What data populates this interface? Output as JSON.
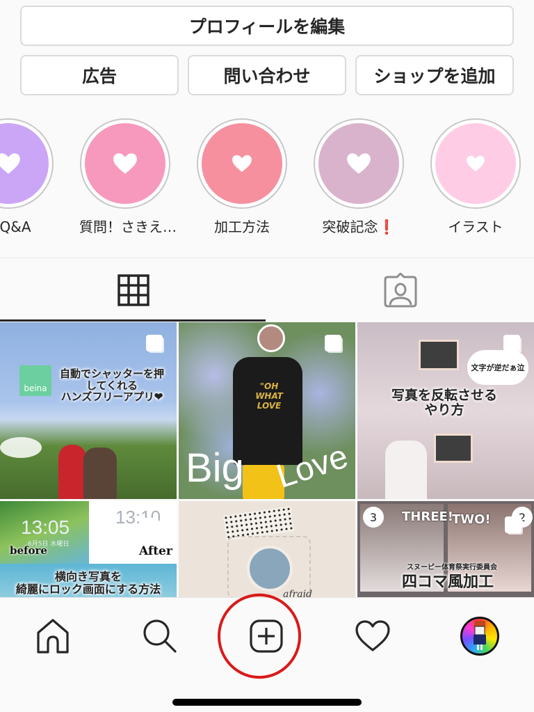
{
  "profile_actions": {
    "edit_profile": "プロフィールを編集",
    "ads": "広告",
    "contact": "問い合わせ",
    "add_shop": "ショップを追加"
  },
  "highlights": [
    {
      "label": "にQ&A",
      "color": "#cba6f7",
      "icon": "heart-icon"
    },
    {
      "label": "質問！さきえ…",
      "color": "#f799bd",
      "icon": "heart-icon"
    },
    {
      "label": "加工方法",
      "color": "#f6909f",
      "icon": "heart-icon"
    },
    {
      "label": "突破記念",
      "suffix": "❗",
      "color": "#d9b3cc",
      "icon": "heart-icon"
    },
    {
      "label": "イラスト",
      "color": "#ffcce6",
      "icon": "heart-icon"
    }
  ],
  "tabs": {
    "grid": {
      "icon": "grid-icon",
      "active": true
    },
    "tagged": {
      "icon": "tagged-user-icon",
      "active": false
    }
  },
  "posts": [
    {
      "caption": "自動でシャッターを押\nしてくれる\nハンズフリーアプリ❤",
      "badge": "beina",
      "multi": true
    },
    {
      "caption": "Big Love",
      "shirt_text": "\"OH WHAT LOVE",
      "multi": true
    },
    {
      "caption": "写真を反転させる\nやり方",
      "bubble": "文字が逆だぁ泣",
      "multi": true
    },
    {
      "caption": "横向き写真を\n綺麗にロック画面にする方法",
      "left_label": "before",
      "right_label": "After",
      "time_left": "13:05",
      "time_right": "13:10",
      "date": "6月5日 水曜日",
      "multi": true
    },
    {
      "caption": "afraid",
      "multi": false
    },
    {
      "caption": "四コマ風加工",
      "subtitle": "スヌーピー体育祭実行委員会",
      "panel_3": "THREE!",
      "panel_2": "TWO!",
      "num_3": "3",
      "num_2": "2",
      "multi": true
    }
  ],
  "nav": {
    "home": "home-icon",
    "search": "search-icon",
    "add": "add-post-icon",
    "activity": "heart-outline-icon",
    "profile": "profile-avatar"
  },
  "colors": {
    "annotation_circle": "#d91a1a",
    "text": "#262626",
    "border": "#dbdbdb"
  }
}
